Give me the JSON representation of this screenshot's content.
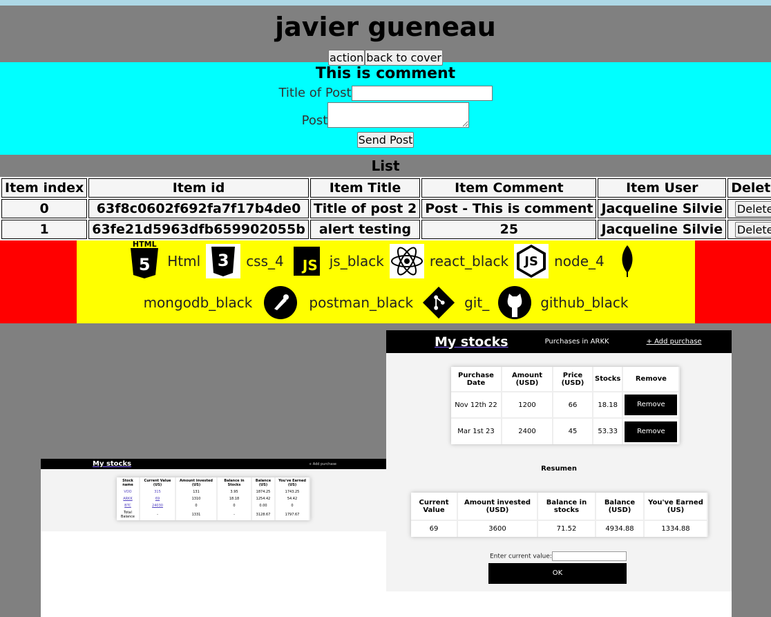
{
  "header": {
    "title": "javier gueneau",
    "action_label": "action",
    "back_label": "back to cover"
  },
  "comment": {
    "heading": "This is comment",
    "title_label": "Title of Post",
    "title_value": "",
    "post_label": "Post",
    "post_value": "",
    "send_label": "Send Post"
  },
  "list": {
    "heading": "List",
    "columns": [
      "Item index",
      "Item id",
      "Item Title",
      "Item Comment",
      "Item User",
      "Delete"
    ],
    "rows": [
      {
        "index": "0",
        "id": "63f8c0602f692fa7f17b4de0",
        "title": "Title of post 2",
        "comment": "Post - This is comment",
        "user": "Jacqueline Silvie",
        "delete": "Delete"
      },
      {
        "index": "1",
        "id": "63fe21d5963dfb659902055b",
        "title": "alert testing",
        "comment": "25",
        "user": "Jacqueline Silvie",
        "delete": "Delete"
      }
    ]
  },
  "tech": {
    "html": "Html",
    "html_badge": "HTML",
    "css": "css_4",
    "js": "js_black",
    "react": "react_black",
    "node": "node_4",
    "mongo": "mongodb_black",
    "postman": "postman_black",
    "git": "git_",
    "github": "github_black",
    "js_glyph": "JS",
    "node_glyph": "JS",
    "html_glyph": "5",
    "css_glyph": "3"
  },
  "shot1": {
    "title": "My stocks",
    "add": "+ Add purchase",
    "columns": [
      "Stock name",
      "Current Value (US)",
      "Amount invested (US)",
      "Balance in Stocks",
      "Balance (US)",
      "You've Earned (US)"
    ],
    "rows": [
      [
        "VOO",
        "315",
        "131",
        "3.95",
        "1874.25",
        "1743.25"
      ],
      [
        "ARKK",
        "69",
        "1310",
        "18.18",
        "1254.42",
        "54.42"
      ],
      [
        "BTC",
        "24030",
        "0",
        "0",
        "0.00",
        "0"
      ],
      [
        "Total Balance",
        "-",
        "1331",
        "-",
        "3128.67",
        "1797.67"
      ]
    ]
  },
  "shot2": {
    "title": "My stocks",
    "subtitle": "Purchases in ARKK",
    "add": "+ Add purchase",
    "purchase_columns": [
      "Purchase Date",
      "Amount (USD)",
      "Price (USD)",
      "Stocks",
      "Remove"
    ],
    "purchases": [
      {
        "date": "Nov 12th 22",
        "amount": "1200",
        "price": "66",
        "stocks": "18.18",
        "remove": "Remove"
      },
      {
        "date": "Mar 1st 23",
        "amount": "2400",
        "price": "45",
        "stocks": "53.33",
        "remove": "Remove"
      }
    ],
    "resumen": "Resumen",
    "summary_columns": [
      "Current Value",
      "Amount invested (USD)",
      "Balance in stocks",
      "Balance (USD)",
      "You've Earned (US)"
    ],
    "summary": [
      "69",
      "3600",
      "71.52",
      "4934.88",
      "1334.88"
    ],
    "enter_label": "Enter current value:",
    "enter_value": "",
    "ok": "OK"
  }
}
